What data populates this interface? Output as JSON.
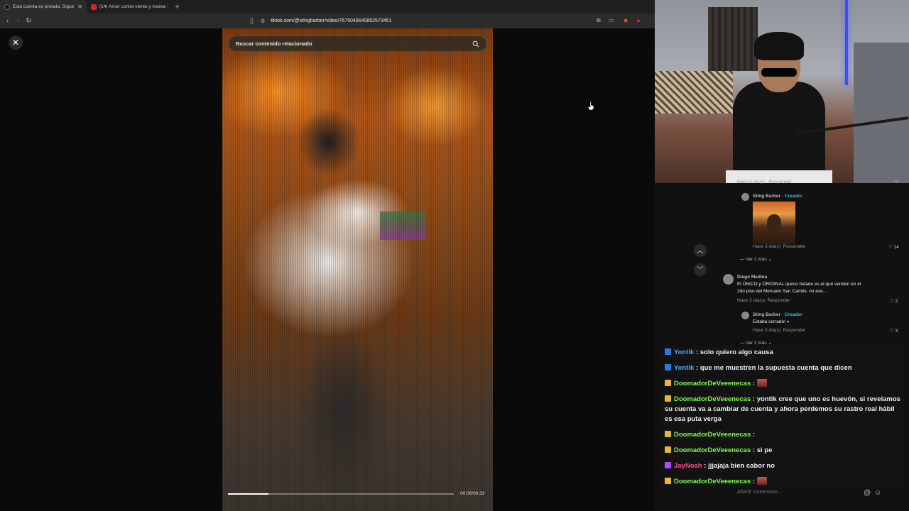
{
  "browser": {
    "tabs": [
      {
        "title": "Esta cuenta es privada. Sigue",
        "active": true
      },
      {
        "title": "(14) Amor contra viento y marea - Tr",
        "active": false
      }
    ],
    "new_tab": "+",
    "url": "tiktok.com/@stingbarber/video/7675049640852573461"
  },
  "viewer": {
    "close": "✕",
    "search_placeholder": "Buscar contenido relacionado",
    "time": "00:06/00:33",
    "progress": 0.18
  },
  "comments": {
    "top_meta": "Hace 3 día(s) · Responder",
    "top_likes": "46",
    "reply1": {
      "name": "Sting Barber",
      "role": "Creador",
      "meta": "Hace 3 día(s)",
      "reply": "Responder",
      "likes": "14"
    },
    "more1": "Ver 1 más",
    "c2": {
      "name": "Diego Medina",
      "text1": "El ÚNICO y ORIGINAL queso helado es el que venden en el",
      "text2": "2do piso del Mercado San Camilo, no ese...",
      "meta": "Hace 3 día(s)",
      "reply": "Responder",
      "likes": "2"
    },
    "reply2": {
      "name": "Sting Barber",
      "role": "Creador",
      "text": "Estaba cerrado!",
      "meta": "Hace 3 día(s)",
      "reply": "Responder",
      "likes": "3"
    },
    "more2": "Ver 2 más",
    "add_comment": "Añadir comentario..."
  },
  "chat": [
    {
      "user": "Yontik",
      "color": "#4fa8ff",
      "badge": "#2f7ad6",
      "text": "solo quiero algo causa"
    },
    {
      "user": "Yontik",
      "color": "#4fa8ff",
      "badge": "#2f7ad6",
      "text": "que me muestren la supuesta cuenta que dicen"
    },
    {
      "user": "DoomadorDeVeeenecas",
      "color": "#7cff4a",
      "badge": "#e8b43a",
      "text": "",
      "emote": true
    },
    {
      "user": "DoomadorDeVeeenecas",
      "color": "#7cff4a",
      "badge": "#e8b43a",
      "text": "yontik cree que uno es huevón, si revelamos su cuenta va a cambiar de cuenta y ahora perdemos su rastro real hábil es esa puta verga"
    },
    {
      "user": "DoomadorDeVeeenecas",
      "color": "#7cff4a",
      "badge": "#e8b43a",
      "text": ""
    },
    {
      "user": "DoomadorDeVeeenecas",
      "color": "#7cff4a",
      "badge": "#e8b43a",
      "text": "si pe"
    },
    {
      "user": "JayNoah",
      "color": "#ff4a8a",
      "badge": "#b04aff",
      "text": "jjjajaja bien cabor no"
    },
    {
      "user": "DoomadorDeVeeenecas",
      "color": "#7cff4a",
      "badge": "#e8b43a",
      "text": "",
      "emote": true
    }
  ]
}
